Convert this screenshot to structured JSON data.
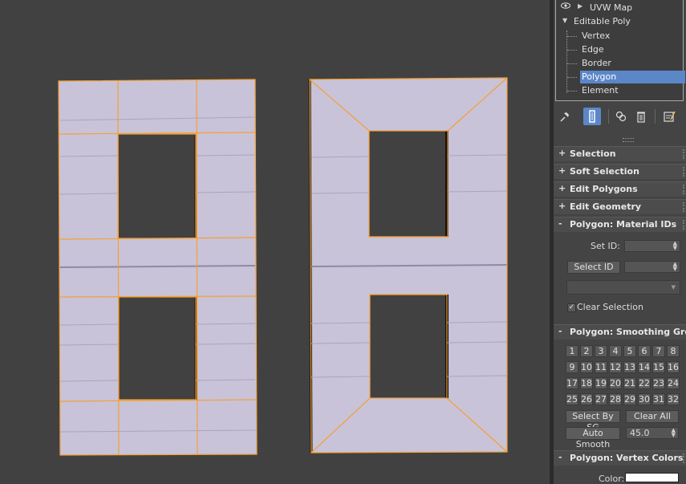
{
  "stack": {
    "uvw_map": "UVW Map",
    "editable_poly": "Editable Poly",
    "sub_objects": [
      "Vertex",
      "Edge",
      "Border",
      "Polygon",
      "Element"
    ],
    "selected_sub_object": "Polygon"
  },
  "rollouts": {
    "selection": "Selection",
    "soft_selection": "Soft Selection",
    "edit_polygons": "Edit Polygons",
    "edit_geometry": "Edit Geometry",
    "material_ids": "Polygon: Material IDs",
    "smoothing_groups": "Polygon: Smoothing Grou",
    "vertex_colors": "Polygon: Vertex Colors"
  },
  "collapsed_sign": "+",
  "expanded_sign": "-",
  "material_ids": {
    "set_id_label": "Set ID:",
    "set_id_value": "",
    "select_id_button": "Select ID",
    "select_id_value": "",
    "clear_selection_label": "Clear Selection",
    "clear_selection_checked": true
  },
  "smoothing": {
    "groups": [
      "1",
      "2",
      "3",
      "4",
      "5",
      "6",
      "7",
      "8",
      "9",
      "10",
      "11",
      "12",
      "13",
      "14",
      "15",
      "16",
      "17",
      "18",
      "19",
      "20",
      "21",
      "22",
      "23",
      "24",
      "25",
      "26",
      "27",
      "28",
      "29",
      "30",
      "31",
      "32"
    ],
    "select_by_sg_button": "Select By SG",
    "clear_all_button": "Clear All",
    "auto_smooth_button": "Auto Smooth",
    "auto_smooth_value": "45.0"
  },
  "vertex_colors": {
    "color_label": "Color:",
    "color_value": "#ffffff"
  },
  "colors": {
    "viewport_bg": "#414141",
    "mesh_fill": "#c8c3d8",
    "selection_edge": "#f5a033",
    "selected_row": "#5b87c9"
  },
  "icons": [
    "eye-icon",
    "pin-stack-icon",
    "show-end-result-icon",
    "make-unique-icon",
    "remove-modifier-icon",
    "configure-modifier-sets-icon"
  ]
}
